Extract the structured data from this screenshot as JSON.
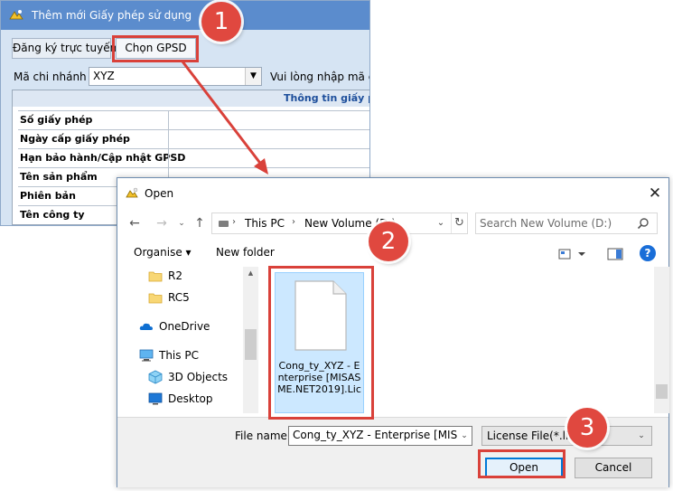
{
  "background_window": {
    "title": "Thêm mới Giấy phép sử dụng",
    "tabs": [
      "Đăng ký trực tuyến",
      "Chọn GPSD"
    ],
    "branch_label": "Mã chi nhánh",
    "branch_value": "XYZ",
    "hint": "Vui lòng nhập mã chi n",
    "info_header": "Thông tin giấy phé",
    "info_rows": [
      "Số giấy phép",
      "Ngày cấp giấy phép",
      "Hạn bảo hành/Cập nhật GPSD",
      "Tên sản phẩm",
      "Phiên bản",
      "Tên công ty"
    ]
  },
  "open_dialog": {
    "title": "Open",
    "address": {
      "segments": [
        "This PC",
        "New Volume (D:)"
      ]
    },
    "search": {
      "placeholder": "Search New Volume (D:)"
    },
    "toolbar": {
      "organise": "Organise ▾",
      "new_folder": "New folder"
    },
    "nav_items": [
      {
        "label": "R2",
        "icon": "folder-icon"
      },
      {
        "label": "RC5",
        "icon": "folder-icon"
      },
      {
        "label": "OneDrive",
        "icon": "onedrive-icon"
      },
      {
        "label": "This PC",
        "icon": "pc-icon"
      },
      {
        "label": "3D Objects",
        "icon": "cube-icon"
      },
      {
        "label": "Desktop",
        "icon": "desktop-icon"
      }
    ],
    "file": {
      "name": "Cong_ty_XYZ - Enterprise [MISASME.NET2019].Lic"
    },
    "file_name_label": "File name:",
    "file_name_value": "Cong_ty_XYZ - Enterprise [MISASM",
    "file_type": "License File(*.lic)",
    "open_label": "Open",
    "cancel_label": "Cancel"
  },
  "callouts": [
    "1",
    "2",
    "3"
  ],
  "colors": {
    "annotation_red": "#d9413a",
    "titlebar_blue": "#5b8ccd",
    "selection_blue": "#cce8ff",
    "accent_blue": "#0078d7"
  }
}
